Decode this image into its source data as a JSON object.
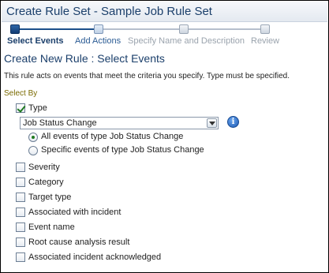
{
  "window": {
    "title": "Create Rule Set - Sample Job Rule Set"
  },
  "train": {
    "steps": [
      {
        "label": "Select Events",
        "state": "current"
      },
      {
        "label": "Add Actions",
        "state": "next"
      },
      {
        "label": "Specify Name and Description",
        "state": "future"
      },
      {
        "label": "Review",
        "state": "future"
      }
    ]
  },
  "page": {
    "title": "Create New Rule : Select Events",
    "description": "This rule acts on events that meet the criteria you specify. Type must be specified.",
    "select_by_label": "Select By"
  },
  "type": {
    "label": "Type",
    "checked": true,
    "selected_value": "Job Status Change",
    "radio_all": "All events of type Job Status Change",
    "radio_specific": "Specific events of type Job Status Change",
    "radio_selected": "all"
  },
  "criteria": [
    {
      "label": "Severity",
      "checked": false
    },
    {
      "label": "Category",
      "checked": false
    },
    {
      "label": "Target type",
      "checked": false
    },
    {
      "label": "Associated with incident",
      "checked": false
    },
    {
      "label": "Event name",
      "checked": false
    },
    {
      "label": "Root cause analysis result",
      "checked": false
    },
    {
      "label": "Associated incident acknowledged",
      "checked": false
    }
  ],
  "colors": {
    "title": "#1b3f6b",
    "accent": "#1b4f8a",
    "check": "#1f7a1f",
    "select_by": "#7a6a00"
  },
  "icons": {
    "info": "info-icon"
  }
}
